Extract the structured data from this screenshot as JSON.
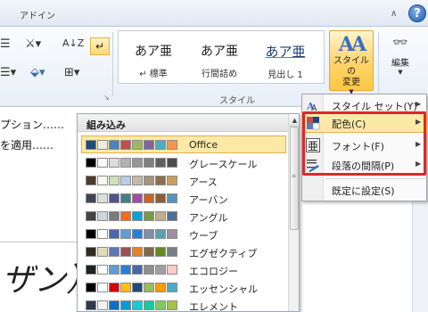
{
  "titlebar": {
    "tab_addin": "アドイン",
    "minimize_ribbon_glyph": "∧",
    "help_glyph": "?"
  },
  "ribbon": {
    "style_gallery": [
      {
        "sample": "あア亜",
        "name": "標準",
        "prefix": "↵"
      },
      {
        "sample": "あア亜",
        "name": "行間詰め",
        "prefix": ""
      },
      {
        "sample": "あア亜",
        "name": "見出し 1",
        "prefix": ""
      }
    ],
    "style_group_label": "スタイル",
    "change_styles_line1": "スタイルの",
    "change_styles_line2": "変更",
    "edit_label": "編集",
    "glyphs": {
      "aa": "AA",
      "binoculars": "⌕",
      "sort": "A↓Z",
      "show_marks": "↵",
      "launcher": "↘",
      "scroll_up": "▲",
      "scroll_down": "▼"
    }
  },
  "document": {
    "line1": "プション……",
    "line2": "を適用……",
    "big_text": "ザン）"
  },
  "gallery": {
    "header": "組み込み",
    "themes": [
      {
        "name": "Office",
        "colors": [
          "#1f497d",
          "#eeece1",
          "#4f81bd",
          "#c0504d",
          "#9bbb59",
          "#8064a2",
          "#4bacc6",
          "#f79646"
        ]
      },
      {
        "name": "グレースケール",
        "colors": [
          "#000000",
          "#f8f8f8",
          "#dddddd",
          "#b2b2b2",
          "#969696",
          "#808080",
          "#5f5f5f",
          "#4d4d4d"
        ]
      },
      {
        "name": "アース",
        "colors": [
          "#4e3b30",
          "#fbf8ef",
          "#cfe1b9",
          "#b9cde5",
          "#c7b8a5",
          "#a49580",
          "#8b6d4f",
          "#cd9b60"
        ]
      },
      {
        "name": "アーバン",
        "colors": [
          "#424456",
          "#dedede",
          "#53548a",
          "#438086",
          "#a04da3",
          "#c4652d",
          "#8b5d3d",
          "#5c92b5"
        ]
      },
      {
        "name": "アングル",
        "colors": [
          "#434342",
          "#cdd7d9",
          "#797b7e",
          "#f96a1b",
          "#08a1d9",
          "#7c984a",
          "#c2ad8d",
          "#506e94"
        ]
      },
      {
        "name": "ウーブ",
        "colors": [
          "#000000",
          "#ffffff",
          "#4a66ac",
          "#629dd1",
          "#297fd5",
          "#7f8fa9",
          "#5aa2ae",
          "#9d90a0"
        ]
      },
      {
        "name": "エグゼクティブ",
        "colors": [
          "#2f2b20",
          "#dfdcb7",
          "#6076b4",
          "#9c5252",
          "#e68422",
          "#846648",
          "#63891f",
          "#758085"
        ]
      },
      {
        "name": "エコロジー",
        "colors": [
          "#1f2123",
          "#fdfdfd",
          "#629dd1",
          "#297fd5",
          "#4a66ac",
          "#8f8f8f",
          "#9f9f9f",
          "#ffcccc"
        ]
      },
      {
        "name": "エッセンシャル",
        "colors": [
          "#000000",
          "#ffffff",
          "#d20000",
          "#ffc000",
          "#1f497d",
          "#9bbb59",
          "#ff9a00",
          "#4bacc6"
        ]
      },
      {
        "name": "エレメント",
        "colors": [
          "#2d3b4c",
          "#f2f2f2",
          "#0f6fc6",
          "#009dd9",
          "#0bd0d9",
          "#10cf9b",
          "#7cca62",
          "#a5c249"
        ]
      }
    ]
  },
  "menu": {
    "items": [
      {
        "label": "スタイル セット(Y)",
        "icon": "style-set-icon",
        "submenu": true
      },
      {
        "label": "配色(C)",
        "icon": "color-scheme-icon",
        "submenu": true,
        "active": true
      },
      {
        "label": "フォント(F)",
        "icon": "font-icon",
        "submenu": true
      },
      {
        "label": "段落の間隔(P)",
        "icon": "paragraph-spacing-icon",
        "submenu": true
      },
      {
        "label": "既定に設定(S)",
        "icon": "",
        "submenu": false
      }
    ],
    "arrow_glyph": "▶",
    "highlight_color": "#e0262b"
  }
}
